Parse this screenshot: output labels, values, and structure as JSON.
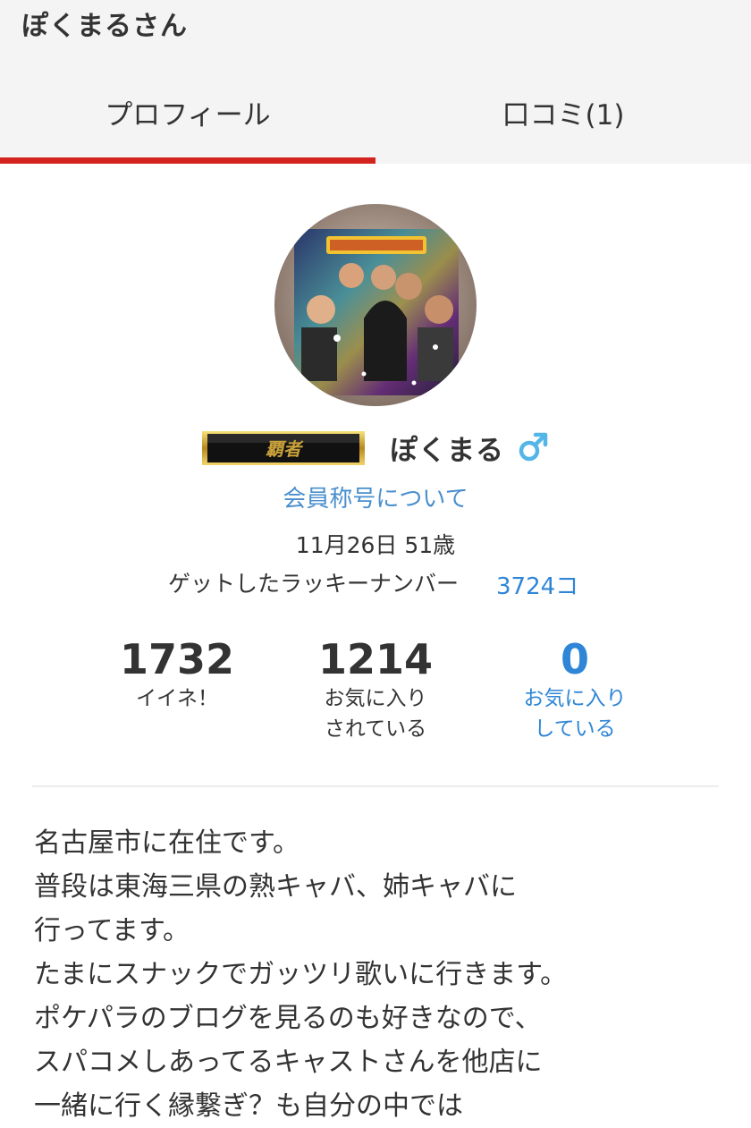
{
  "header": {
    "title": "ぽくまるさん"
  },
  "tabs": [
    {
      "label": "プロフィール",
      "active": true
    },
    {
      "label": "口コミ(1)",
      "active": false
    }
  ],
  "colors": {
    "accent_red": "#d2231f",
    "link_blue": "#2f86d6"
  },
  "profile": {
    "rank_badge_text": "覇者",
    "name": "ぽくまる",
    "gender_icon": "male-icon",
    "member_title_link": "会員称号について",
    "birthday_age": "11月26日 51歳",
    "lucky_number_label": "ゲットしたラッキーナンバー",
    "lucky_number_value": "3724コ"
  },
  "stats": [
    {
      "value": "1732",
      "label": "イイネ！"
    },
    {
      "value": "1214",
      "label": "お気に入り\nされている"
    },
    {
      "value": "0",
      "label": "お気に入り\nしている"
    }
  ],
  "bio": [
    "名古屋市に在住です。",
    "普段は東海三県の熟キャバ、姉キャバに",
    "行ってます。",
    "たまにスナックでガッツリ歌いに行きます。",
    "ポケパラのブログを見るのも好きなので、",
    "スパコメしあってるキャストさんを他店に",
    "一緒に行く縁繋ぎ？も自分の中では"
  ]
}
